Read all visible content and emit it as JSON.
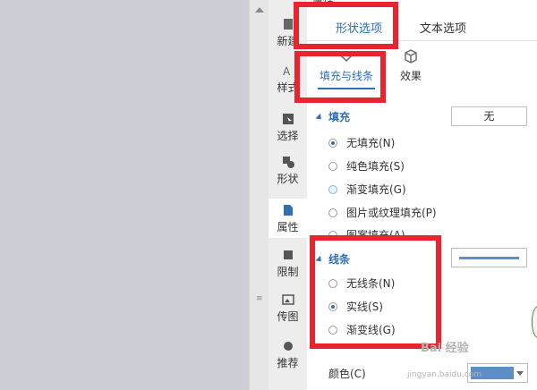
{
  "panel": {
    "title": "属性"
  },
  "toolstrip": {
    "items": [
      {
        "label": "新建"
      },
      {
        "label": "样式"
      },
      {
        "label": "选择"
      },
      {
        "label": "形状"
      },
      {
        "label": "属性"
      },
      {
        "label": "限制"
      },
      {
        "label": "传图"
      },
      {
        "label": "推荐"
      }
    ]
  },
  "tabs": {
    "shape_options": "形状选项",
    "text_options": "文本选项"
  },
  "subtabs": {
    "fill_line": "填充与线条",
    "effects": "效果"
  },
  "fill": {
    "section_label": "填充",
    "current_value": "无",
    "options": [
      "无填充(N)",
      "纯色填充(S)",
      "渐变填充(G)",
      "图片或纹理填充(P)",
      "图案填充(A)"
    ],
    "selected": "无填充(N)"
  },
  "line": {
    "section_label": "线条",
    "options": [
      "无线条(N)",
      "实线(S)",
      "渐变线(G)"
    ],
    "selected": "实线(S)",
    "color_label": "颜色(C)",
    "color": "#5b8fc9"
  },
  "accent_color": "#2f6fb5",
  "highlight_color": "#e8242f",
  "watermark": {
    "text": "Bai 经验",
    "url": "jingyan.baidu.com"
  }
}
